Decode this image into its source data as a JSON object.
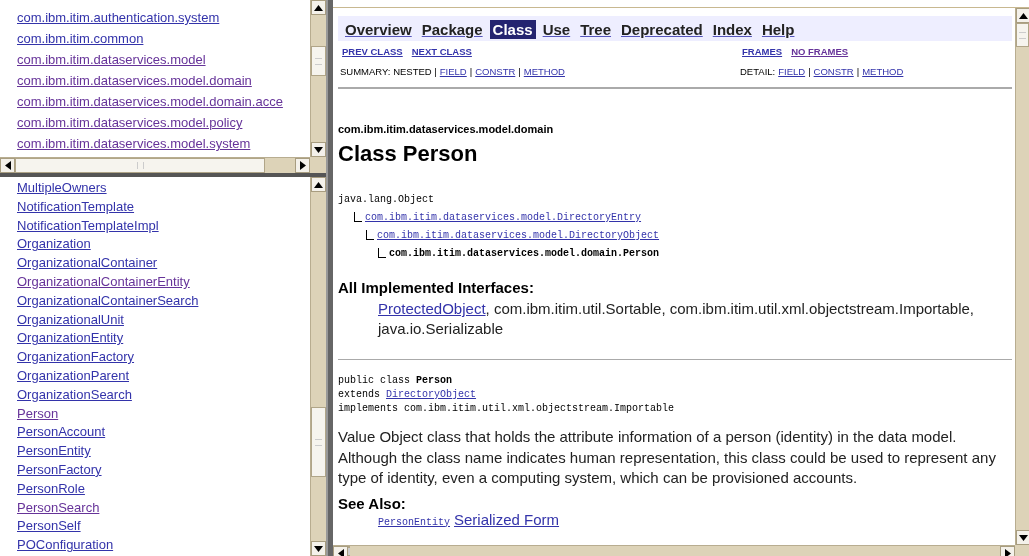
{
  "packages_frame": {
    "items": [
      {
        "label": "com.ibm.itim.authentication.system",
        "visited": false
      },
      {
        "label": "com.ibm.itim.common",
        "visited": false
      },
      {
        "label": "com.ibm.itim.dataservices.model",
        "visited": true
      },
      {
        "label": "com.ibm.itim.dataservices.model.domain",
        "visited": true
      },
      {
        "label": "com.ibm.itim.dataservices.model.domain.acce",
        "visited": true
      },
      {
        "label": "com.ibm.itim.dataservices.model.policy",
        "visited": true
      },
      {
        "label": "com.ibm.itim.dataservices.model.system",
        "visited": true
      }
    ]
  },
  "classes_frame": {
    "items": [
      {
        "label": "MultipleOwners",
        "visited": false
      },
      {
        "label": "NotificationTemplate",
        "visited": false
      },
      {
        "label": "NotificationTemplateImpl",
        "visited": false
      },
      {
        "label": "Organization",
        "visited": false
      },
      {
        "label": "OrganizationalContainer",
        "visited": false
      },
      {
        "label": "OrganizationalContainerEntity",
        "visited": true
      },
      {
        "label": "OrganizationalContainerSearch",
        "visited": false
      },
      {
        "label": "OrganizationalUnit",
        "visited": false
      },
      {
        "label": "OrganizationEntity",
        "visited": false
      },
      {
        "label": "OrganizationFactory",
        "visited": false
      },
      {
        "label": "OrganizationParent",
        "visited": false
      },
      {
        "label": "OrganizationSearch",
        "visited": false
      },
      {
        "label": "Person",
        "visited": true
      },
      {
        "label": "PersonAccount",
        "visited": false
      },
      {
        "label": "PersonEntity",
        "visited": false
      },
      {
        "label": "PersonFactory",
        "visited": false
      },
      {
        "label": "PersonRole",
        "visited": false
      },
      {
        "label": "PersonSearch",
        "visited": true
      },
      {
        "label": "PersonSelf",
        "visited": false
      },
      {
        "label": "POConfiguration",
        "visited": false
      }
    ]
  },
  "class_frame": {
    "nav_bar": [
      {
        "label": "Overview",
        "selected": false
      },
      {
        "label": "Package",
        "selected": false
      },
      {
        "label": "Class",
        "selected": true
      },
      {
        "label": "Use",
        "selected": false
      },
      {
        "label": "Tree",
        "selected": false
      },
      {
        "label": "Deprecated",
        "selected": false
      },
      {
        "label": "Index",
        "selected": false
      },
      {
        "label": "Help",
        "selected": false
      }
    ],
    "sub_nav_left": [
      {
        "label": "PREV CLASS",
        "visited": false
      },
      {
        "label": "NEXT CLASS",
        "visited": false
      }
    ],
    "sub_nav_right": [
      {
        "label": "FRAMES",
        "visited": false
      },
      {
        "label": "NO FRAMES",
        "visited": true
      }
    ],
    "summary": [
      {
        "kind": "text",
        "text": "SUMMARY: NESTED |"
      },
      {
        "kind": "link",
        "text": "FIELD"
      },
      {
        "kind": "text",
        "text": "|"
      },
      {
        "kind": "link",
        "text": "CONSTR"
      },
      {
        "kind": "text",
        "text": "|"
      },
      {
        "kind": "link",
        "text": "METHOD"
      }
    ],
    "detail": [
      {
        "kind": "text",
        "text": "DETAIL:"
      },
      {
        "kind": "link",
        "text": "FIELD"
      },
      {
        "kind": "text",
        "text": "|"
      },
      {
        "kind": "link",
        "text": "CONSTR"
      },
      {
        "kind": "text",
        "text": "|"
      },
      {
        "kind": "link",
        "text": "METHOD"
      }
    ],
    "package_name": "com.ibm.itim.dataservices.model.domain",
    "class_title": "Class Person",
    "inheritance": {
      "name": "java.lang.Object",
      "link": false,
      "children": [
        {
          "name": "com.ibm.itim.dataservices.model.DirectoryEntry",
          "link": true,
          "children": [
            {
              "name": "com.ibm.itim.dataservices.model.DirectoryObject",
              "link": true,
              "children": [
                {
                  "name": "com.ibm.itim.dataservices.model.domain.Person",
                  "link": false,
                  "current": true
                }
              ]
            }
          ]
        }
      ]
    },
    "interfaces": {
      "heading": "All Implemented Interfaces:",
      "link": "ProtectedObject",
      "text": ", com.ibm.itim.util.Sortable, com.ibm.itim.util.xml.objectstream.Importable, java.io.Serializable"
    },
    "declaration": {
      "signature": "public class **Person**",
      "extends_prefix": "extends ",
      "extends_link": "DirectoryObject",
      "implements": "implements com.ibm.itim.util.xml.objectstream.Importable"
    },
    "description": "Value Object class that holds the attribute information of a person (identity) in the data model. Although the class name indicates human representation, this class could be used to represent any type of identity, even a computing system, which can be provisioned accounts.",
    "see_also": {
      "heading": "See Also:",
      "links": [
        "PersonEntity",
        "Serialized Form"
      ]
    }
  }
}
